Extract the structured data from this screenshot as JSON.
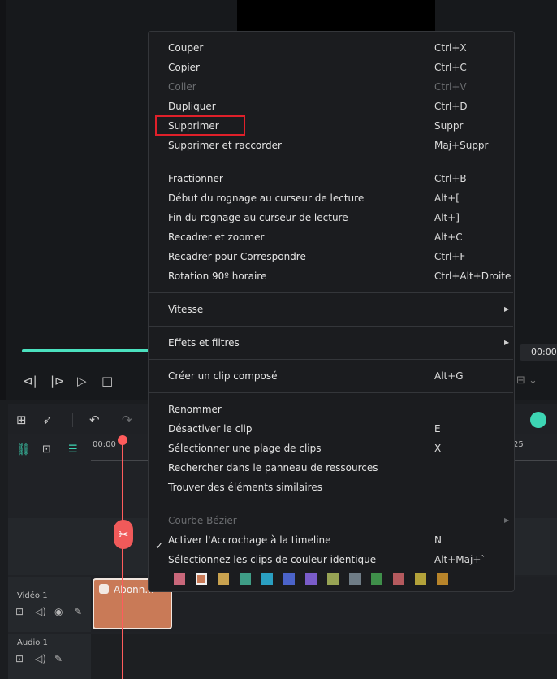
{
  "player": {
    "timecode": "00:00:"
  },
  "timeline": {
    "ruler_start": "00:00",
    "ruler_end": "25",
    "tracks": {
      "video_label": "Vidéo 1",
      "audio_label": "Audio 1"
    },
    "clip_label": "Abonn..."
  },
  "menu": {
    "group1": [
      {
        "label": "Couper",
        "shortcut": "Ctrl+X",
        "enabled": true
      },
      {
        "label": "Copier",
        "shortcut": "Ctrl+C",
        "enabled": true
      },
      {
        "label": "Coller",
        "shortcut": "Ctrl+V",
        "enabled": false
      },
      {
        "label": "Dupliquer",
        "shortcut": "Ctrl+D",
        "enabled": true
      },
      {
        "label": "Supprimer",
        "shortcut": "Suppr",
        "enabled": true,
        "highlighted": true
      },
      {
        "label": "Supprimer et raccorder",
        "shortcut": "Maj+Suppr",
        "enabled": true
      }
    ],
    "group2": [
      {
        "label": "Fractionner",
        "shortcut": "Ctrl+B"
      },
      {
        "label": "Début du rognage au curseur de lecture",
        "shortcut": "Alt+["
      },
      {
        "label": "Fin du rognage au curseur de lecture",
        "shortcut": "Alt+]"
      },
      {
        "label": "Recadrer et zoomer",
        "shortcut": "Alt+C"
      },
      {
        "label": "Recadrer pour Correspondre",
        "shortcut": "Ctrl+F"
      },
      {
        "label": "Rotation 90º horaire",
        "shortcut": "Ctrl+Alt+Droite"
      }
    ],
    "vitesse": "Vitesse",
    "effets": "Effets et filtres",
    "compose": {
      "label": "Créer un clip composé",
      "shortcut": "Alt+G"
    },
    "group5": [
      {
        "label": "Renommer",
        "shortcut": ""
      },
      {
        "label": "Désactiver le clip",
        "shortcut": "E"
      },
      {
        "label": "Sélectionner une plage de clips",
        "shortcut": "X"
      },
      {
        "label": "Rechercher dans le panneau de ressources",
        "shortcut": ""
      },
      {
        "label": "Trouver des éléments similaires",
        "shortcut": ""
      }
    ],
    "group6": [
      {
        "label": "Courbe Bézier",
        "enabled": false
      },
      {
        "label": "Activer l'Accrochage à la timeline",
        "shortcut": "N",
        "checked": true
      },
      {
        "label": "Sélectionnez les clips de couleur identique",
        "shortcut": "Alt+Maj+`"
      }
    ],
    "colors": [
      "#c9677a",
      "#c97a57",
      "#c9a24f",
      "#3f9d86",
      "#2a9fc1",
      "#4b63c9",
      "#7a5cc9",
      "#97a354",
      "#6f7c86",
      "#3f8f4a",
      "#b55a5e",
      "#b3a23a",
      "#b8842a"
    ]
  }
}
